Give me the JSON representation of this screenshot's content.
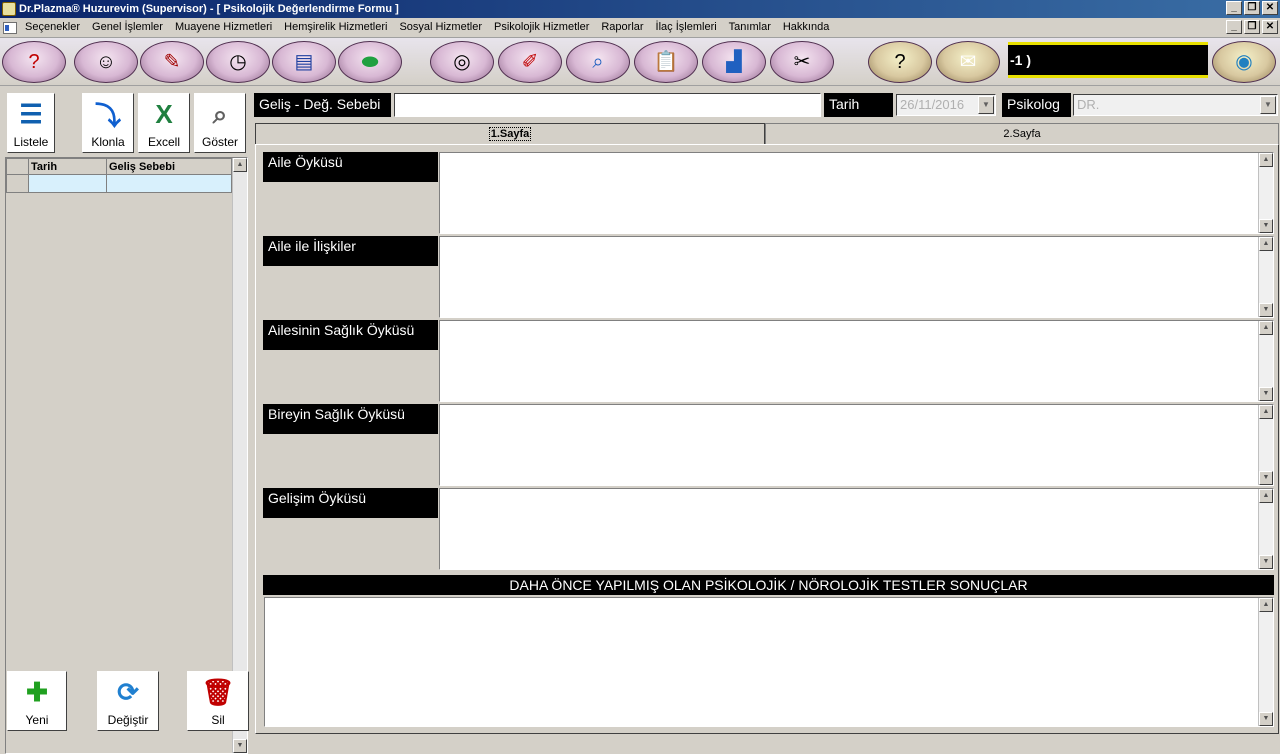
{
  "window": {
    "title": "Dr.Plazma® Huzurevim (Supervisor) - [ Psikolojik Değerlendirme Formu ]",
    "controls": [
      "_",
      "❐",
      "✕"
    ]
  },
  "menu": {
    "items": [
      "Seçenekler",
      "Genel İşlemler",
      "Muayene Hizmetleri",
      "Hemşirelik Hizmetleri",
      "Sosyal Hizmetler",
      "Psikolojik Hizmetler",
      "Raporlar",
      "İlaç İşlemleri",
      "Tanımlar",
      "Hakkında"
    ],
    "controls": [
      "_",
      "❐",
      "✕"
    ]
  },
  "toolbar": {
    "display_text": "-1 )",
    "icons": [
      "help-head",
      "doctors",
      "tools",
      "stopwatch",
      "doc-word",
      "pills",
      "spiral",
      "note",
      "search-doc",
      "clipboard",
      "chart",
      "wrench",
      "question-note",
      "mail",
      "globe"
    ]
  },
  "left": {
    "buttons": {
      "listele": "Listele",
      "klonla": "Klonla",
      "excell": "Excell",
      "goster": "Göster",
      "yeni": "Yeni",
      "degistir": "Değiştir",
      "sil": "Sil"
    },
    "grid": {
      "columns": [
        "Tarih",
        "Geliş Sebebi"
      ],
      "rows": [
        [
          "",
          ""
        ]
      ]
    }
  },
  "header": {
    "gelis_label": "Geliş - Değ. Sebebi",
    "gelis_value": "",
    "tarih_label": "Tarih",
    "tarih_value": "26/11/2016",
    "psikolog_label": "Psikolog",
    "psikolog_value": "DR."
  },
  "tabs": [
    "1.Sayfa",
    "2.Sayfa"
  ],
  "sections": [
    {
      "label": "Aile Öyküsü",
      "value": ""
    },
    {
      "label": "Aile ile İlişkiler",
      "value": ""
    },
    {
      "label": "Ailesinin Sağlık Öyküsü",
      "value": ""
    },
    {
      "label": "Bireyin Sağlık Öyküsü",
      "value": ""
    },
    {
      "label": "Gelişim Öyküsü",
      "value": ""
    }
  ],
  "tests": {
    "title": "DAHA ÖNCE YAPILMIŞ OLAN PSİKOLOJİK / NÖROLOJİK TESTLER SONUÇLAR",
    "value": ""
  },
  "colors": {
    "window_bg": "#d4d0c8",
    "title_bar": "#0a246a",
    "label_bg": "#000000",
    "display_border": "#e8e000",
    "selected_row": "#d8f0fc"
  }
}
